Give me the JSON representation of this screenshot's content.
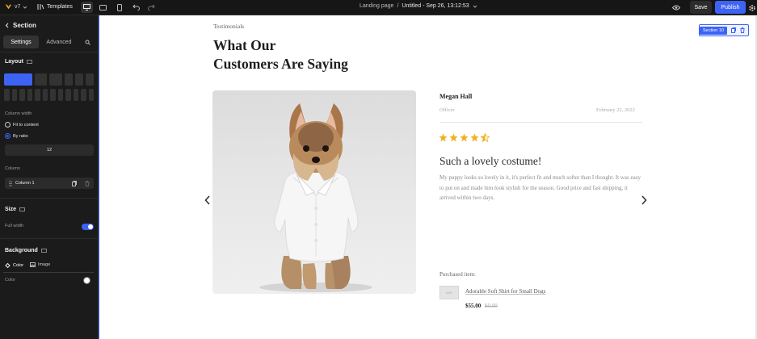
{
  "topbar": {
    "version": "v7",
    "templates_label": "Templates",
    "page_path": "Landing page",
    "page_sep": "/",
    "doc_name": "Untitled - Sep 26, 13:12:53",
    "save_label": "Save",
    "publish_label": "Publish",
    "accent_color": "#3d63f5"
  },
  "sidebar": {
    "title": "Section",
    "tabs": [
      "Settings",
      "Advanced"
    ],
    "layout_heading": "Layout",
    "column_width_label": "Column width",
    "radio_fit": "Fit to content",
    "radio_ratio": "By ratio",
    "ratio_value": "12",
    "column_label": "Column",
    "column_item": "Column 1",
    "size_heading": "Size",
    "full_width_label": "Full width",
    "full_width_on": true,
    "background_heading": "Background",
    "bg_tabs": [
      "Color",
      "Image"
    ],
    "color_label": "Color",
    "color_value": "#ffffff"
  },
  "canvas": {
    "section_badge": "Section 10",
    "eyebrow": "Testimonials",
    "title_line1": "What Our",
    "title_line2": "Customers Are Saying",
    "author": "Megan Hall",
    "office": "Officer",
    "date": "February 22, 2022",
    "rating": 4.5,
    "star_color": "#f2b01e",
    "review_title": "Such a lovely costume!",
    "review_body": "My puppy looks so lovely in it, it's perfect fit and much softer than I thought. It was easy to put on and made him look stylish for the season. Good price and fast shipping, it arrived within two days.",
    "purchased_label": "Purchased item:",
    "product_name": "Adorable Soft Shirt for Small Dogs",
    "thumb_text": "IMG",
    "price": "$55.00",
    "old_price": "$0.00"
  }
}
